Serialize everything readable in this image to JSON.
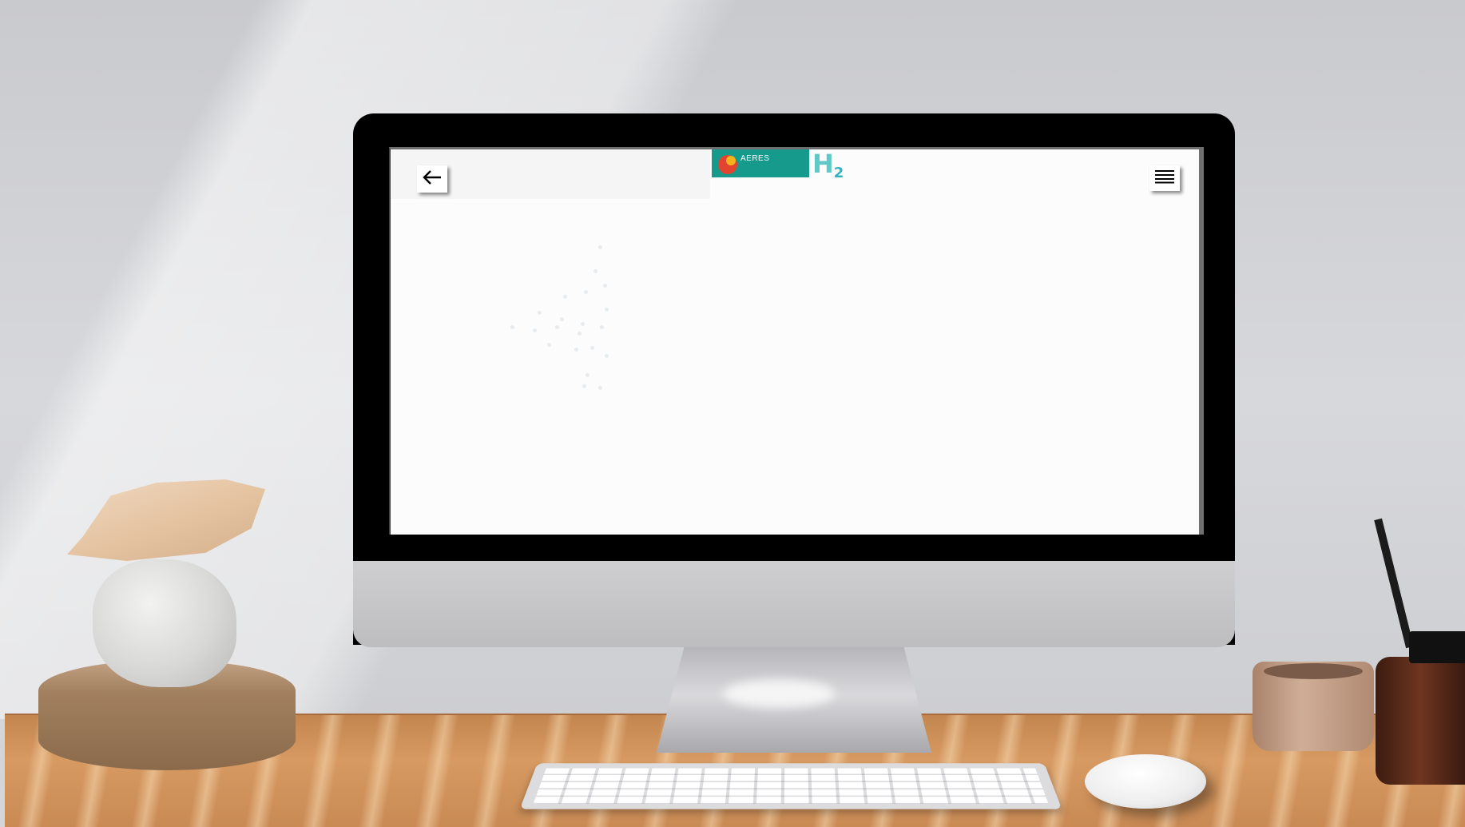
{
  "app": {
    "logo_text": "AERES",
    "logo_h2_main": "H",
    "logo_h2_sub": "2"
  },
  "toolbar": {
    "back_icon": "←",
    "menu_icon": "☰"
  },
  "colors": {
    "teal_accent": "#159a8c",
    "h2_color": "#5ec9c6",
    "logo_red": "#e2452f",
    "logo_yellow": "#f4b31b"
  },
  "icons": {
    "back": "arrow-left-icon",
    "menu": "hamburger-menu-icon"
  }
}
